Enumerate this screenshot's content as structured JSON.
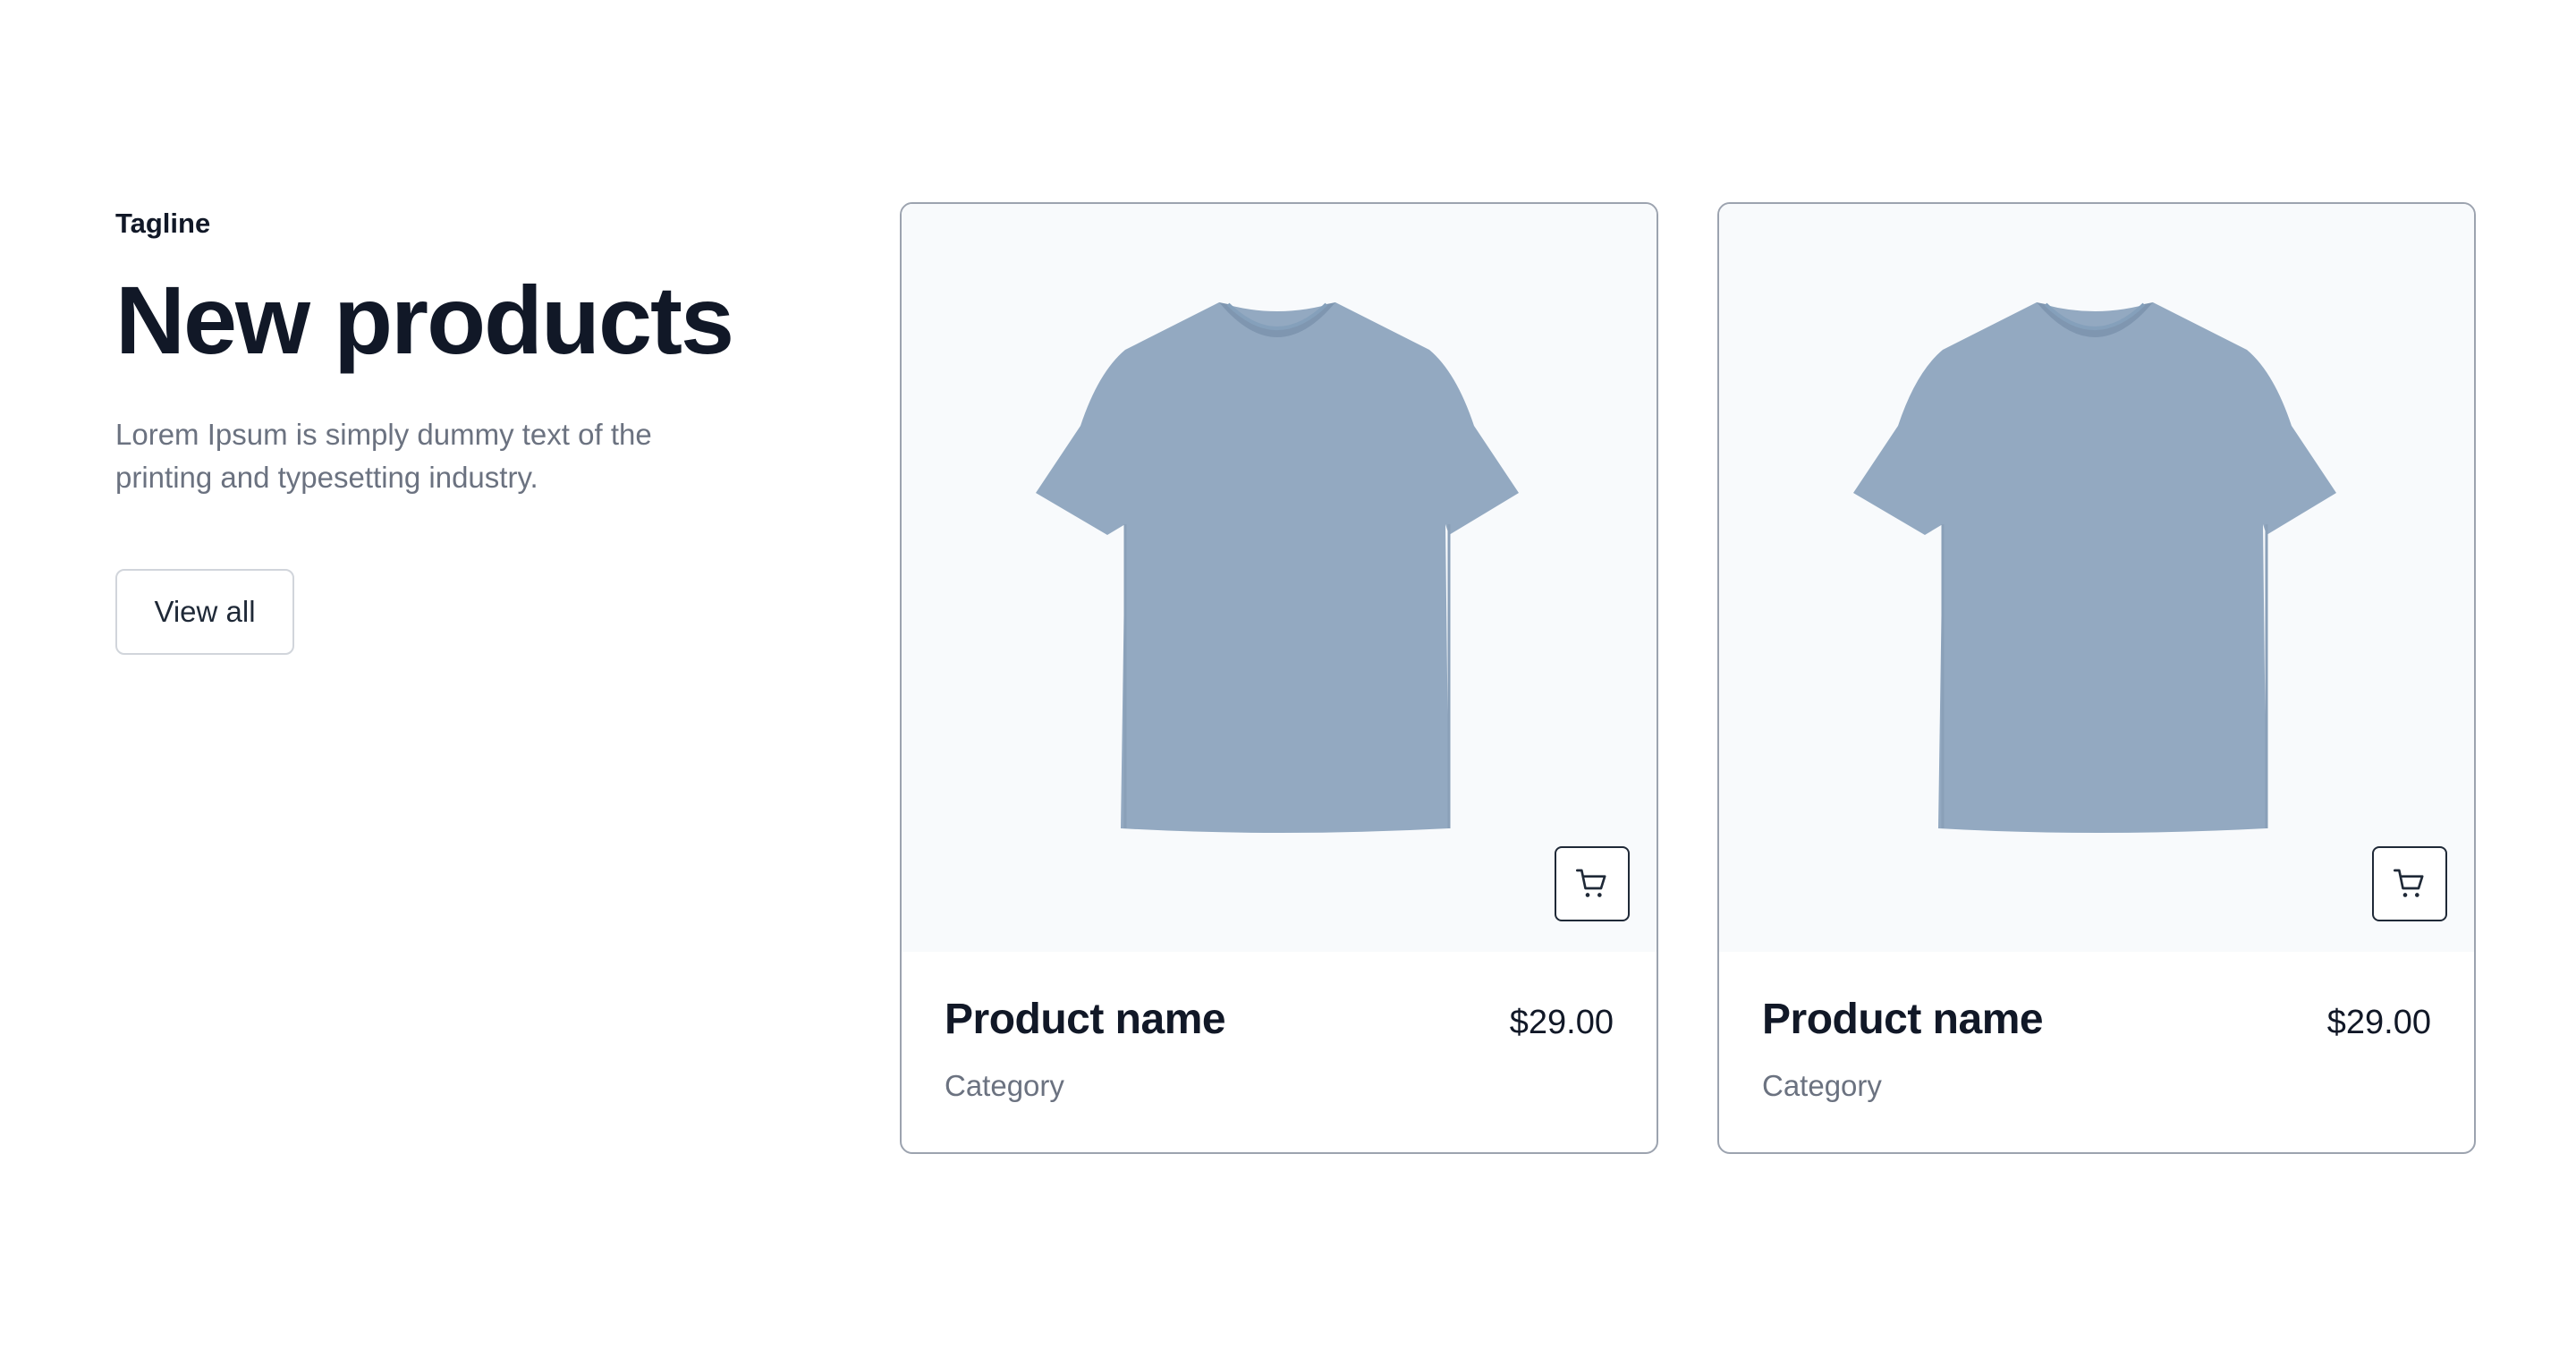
{
  "section": {
    "tagline": "Tagline",
    "title": "New products",
    "description": "Lorem Ipsum is simply dummy text of the printing and typesetting industry.",
    "view_all_label": "View all"
  },
  "products": [
    {
      "name": "Product name",
      "price": "$29.00",
      "category": "Category",
      "image": "t-shirt-image",
      "cart_icon": "shopping-cart-icon"
    },
    {
      "name": "Product name",
      "price": "$29.00",
      "category": "Category",
      "image": "t-shirt-image",
      "cart_icon": "shopping-cart-icon"
    }
  ],
  "colors": {
    "heading": "#111827",
    "muted": "#6b7280",
    "card_border": "#9ca3af",
    "image_bg": "#f8fafc",
    "shirt": "#93a9c1"
  }
}
